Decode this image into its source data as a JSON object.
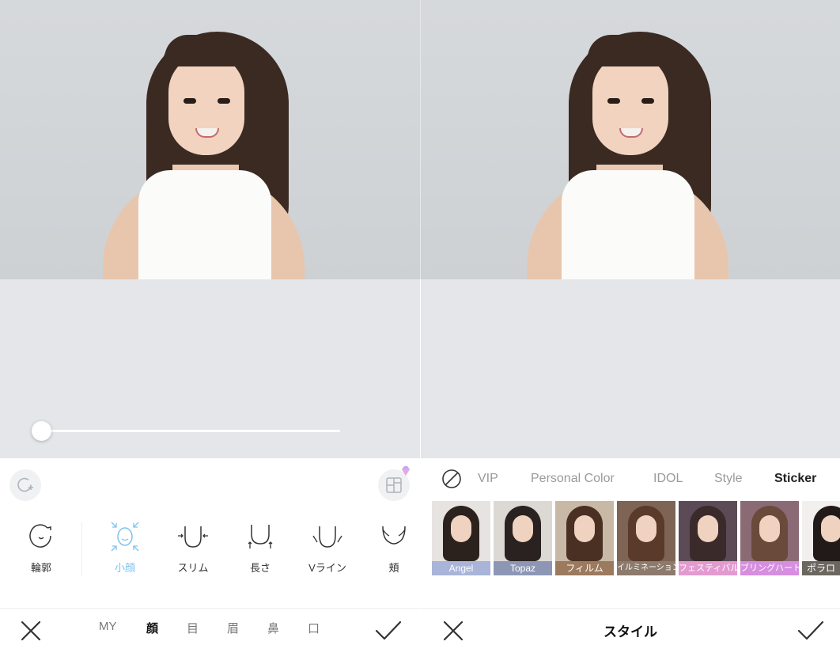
{
  "left": {
    "tools": [
      {
        "name": "contour",
        "label": "輪郭"
      },
      {
        "name": "small-face",
        "label": "小顔"
      },
      {
        "name": "slim",
        "label": "スリム"
      },
      {
        "name": "length",
        "label": "長さ"
      },
      {
        "name": "v-line",
        "label": "Vライン"
      },
      {
        "name": "cheek",
        "label": "頬"
      }
    ],
    "categories": [
      "MY",
      "顔",
      "目",
      "眉",
      "鼻",
      "口"
    ],
    "active_category": "顔",
    "active_tool": "小顔",
    "slider_value": 0
  },
  "right": {
    "filter_tabs": [
      "VIP",
      "Personal Color",
      "IDOL",
      "Style",
      "Sticker"
    ],
    "active_tab": "Sticker",
    "stickers": [
      {
        "label": "Angel",
        "color": "#a8b4d8"
      },
      {
        "label": "Topaz",
        "color": "#8d97b5"
      },
      {
        "label": "フィルム",
        "color": "#9b7a5e"
      },
      {
        "label": "イルミネーション",
        "color": "#8c7a6c"
      },
      {
        "label": "フェスティバル",
        "color": "#e39ad0"
      },
      {
        "label": "ブリングハート",
        "color": "#d58ee0"
      },
      {
        "label": "ポラロ",
        "color": "#6b6660"
      }
    ],
    "title": "スタイル"
  },
  "colors": {
    "accent": "#7cc3ef",
    "canvas": "#e5e6ea",
    "gem": "#c7a6f5"
  }
}
